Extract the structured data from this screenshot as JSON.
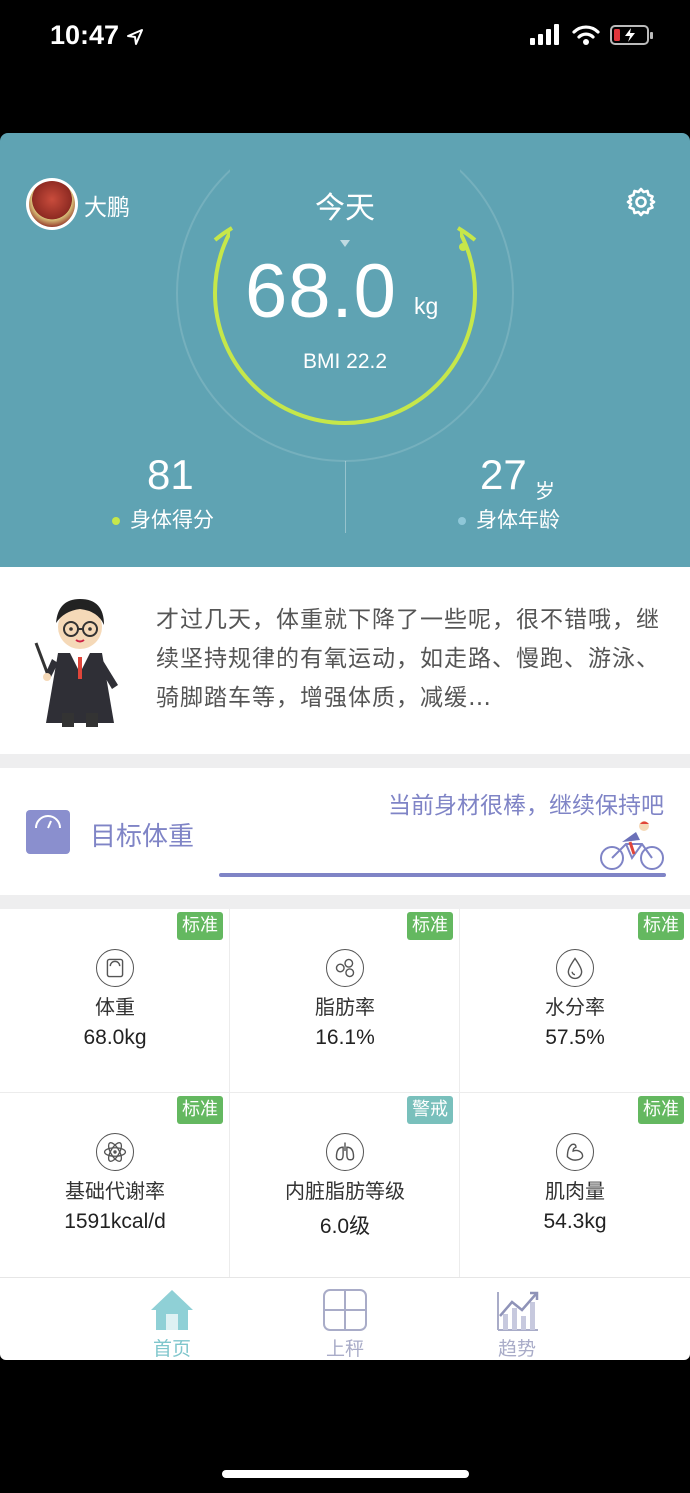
{
  "status_bar": {
    "time": "10:47"
  },
  "header": {
    "username": "大鹏",
    "title": "今天",
    "weight": {
      "value": "68.0",
      "unit": "kg"
    },
    "bmi": "BMI 22.2",
    "body_score": {
      "value": "81",
      "label": "身体得分",
      "dot_color": "#c6e74a"
    },
    "body_age": {
      "value": "27",
      "unit": "岁",
      "label": "身体年龄",
      "dot_color": "#8fc7d8"
    },
    "ring_color": "#c6e74a",
    "background": "#5fa3b3"
  },
  "tip": {
    "text": "才过几天，体重就下降了一些呢，很不错哦，继续坚持规律的有氧运动，如走路、慢跑、游泳、骑脚踏车等，增强体质，减缓…"
  },
  "goal": {
    "label": "目标体重",
    "message": "当前身材很棒，继续保持吧",
    "progress": 1.0,
    "accent": "#7f84c6"
  },
  "metrics": [
    {
      "name": "体重",
      "value": "68.0kg",
      "badge": "标准",
      "icon": "scale-icon"
    },
    {
      "name": "脂肪率",
      "value": "16.1%",
      "badge": "标准",
      "icon": "fat-icon"
    },
    {
      "name": "水分率",
      "value": "57.5%",
      "badge": "标准",
      "icon": "water-drop-icon"
    },
    {
      "name": "基础代谢率",
      "value": "1591kcal/d",
      "badge": "标准",
      "icon": "atom-icon"
    },
    {
      "name": "内脏脂肪等级",
      "value": "6.0级",
      "badge": "警戒",
      "icon": "lungs-icon"
    },
    {
      "name": "肌肉量",
      "value": "54.3kg",
      "badge": "标准",
      "icon": "muscle-icon"
    }
  ],
  "tabs": [
    {
      "label": "首页",
      "icon": "home-icon",
      "active": true
    },
    {
      "label": "上秤",
      "icon": "scale-pad-icon",
      "active": false
    },
    {
      "label": "趋势",
      "icon": "trend-chart-icon",
      "active": false
    }
  ]
}
